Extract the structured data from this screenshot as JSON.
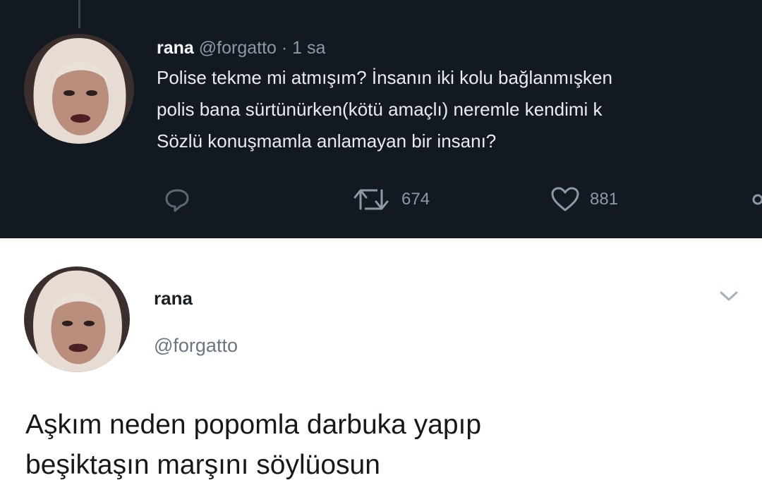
{
  "top_tweet": {
    "name": "rana",
    "handle": "@forgatto",
    "separator": "·",
    "time": "1 sa",
    "lines": [
      "Polise tekme mi atmışım? İnsanın iki kolu bağlanmışken",
      "polis bana sürtünürken(kötü amaçlı) neremle kendimi k",
      "Sözlü konuşmamla anlamayan bir insanı?"
    ],
    "actions": {
      "reply_icon": "reply-icon",
      "retweet_icon": "retweet-icon",
      "retweet_count": "674",
      "like_icon": "heart-icon",
      "like_count": "881",
      "share_icon": "share-icon"
    },
    "colors": {
      "background": "#131921",
      "text": "#e9ecef",
      "muted": "#8d99a6"
    }
  },
  "bottom_tweet": {
    "name": "rana",
    "handle": "@forgatto",
    "menu_icon": "chevron-down-icon",
    "lines": [
      "Aşkım neden popomla darbuka yapıp",
      "beşiktaşın marşını söylüosun"
    ],
    "colors": {
      "background": "#ffffff",
      "text": "#16191c",
      "muted": "#697580"
    }
  }
}
